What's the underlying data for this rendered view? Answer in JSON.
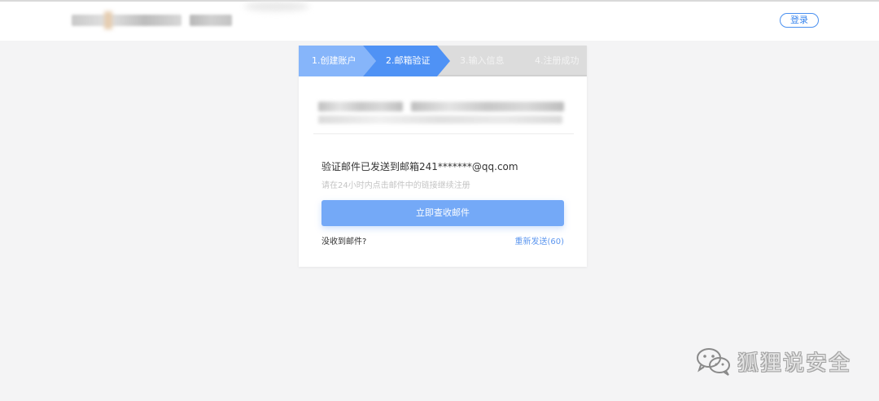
{
  "header": {
    "login_label": "登录"
  },
  "steps": [
    {
      "label": "1.创建账户",
      "state": "done"
    },
    {
      "label": "2.邮箱验证",
      "state": "active"
    },
    {
      "label": "3.输入信息",
      "state": "pending"
    },
    {
      "label": "4.注册成功",
      "state": "pending"
    }
  ],
  "verify": {
    "sent_message": "验证邮件已发送到邮箱241*******@qq.com",
    "hint": "请在24小时内点击邮件中的链接继续注册",
    "check_button": "立即查收邮件",
    "no_mail": "没收到邮件?",
    "resend": "重新发送(60)"
  },
  "watermark": {
    "text": "狐狸说安全"
  },
  "colors": {
    "step_done": "#86b5fa",
    "step_active": "#4f92f5",
    "step_pending": "#dcdcdc",
    "primary_button": "#74a9f7",
    "link": "#5d97ef",
    "page_bg": "#f4f4f5"
  }
}
